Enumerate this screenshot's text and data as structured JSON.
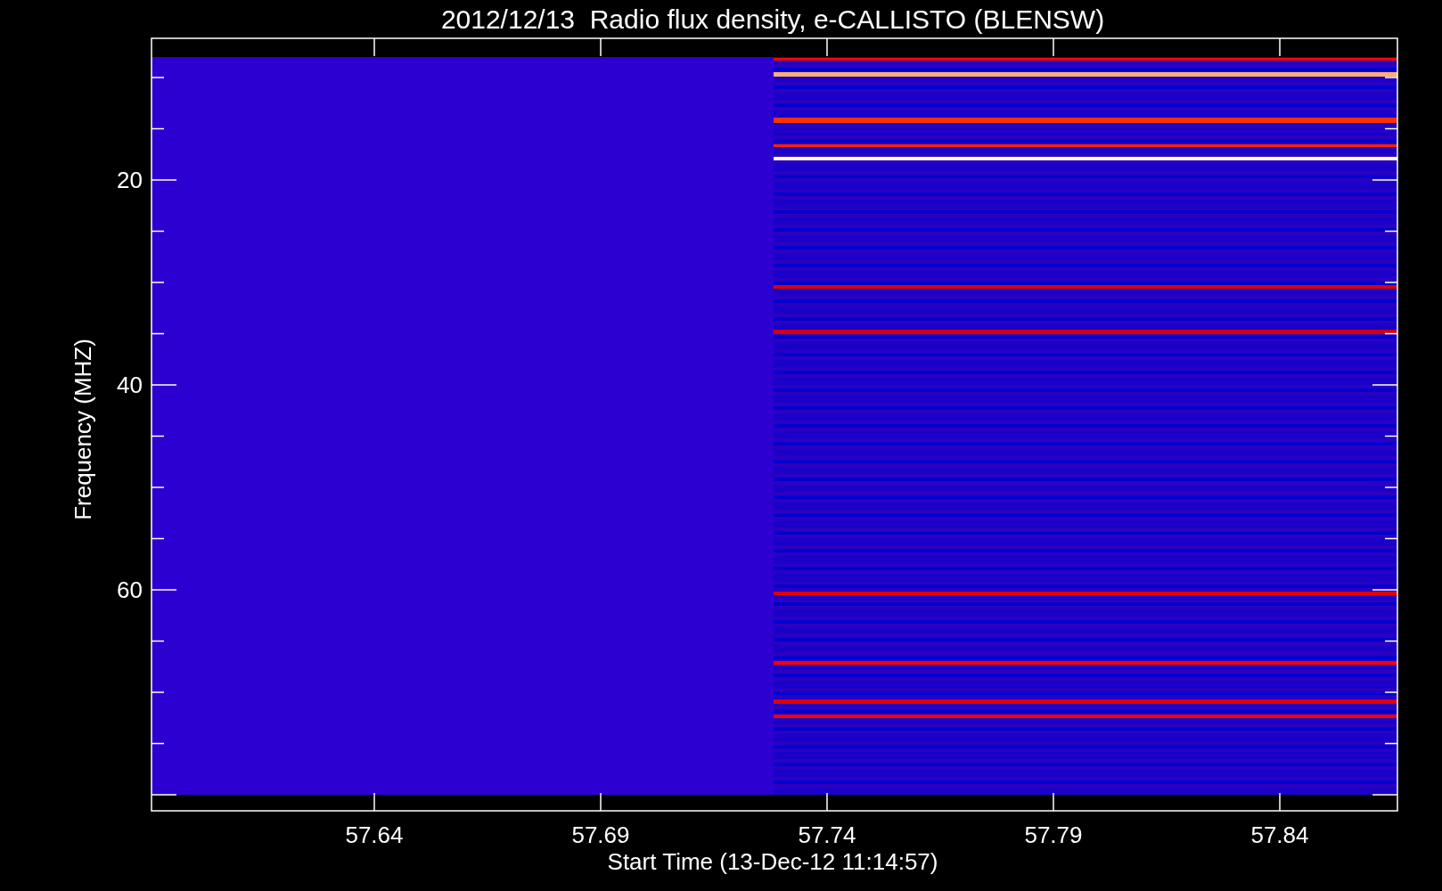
{
  "plot": {
    "title": "2012/12/13  Radio flux density, e-CALLISTO (BLENSW)",
    "xlabel": "Start Time (13-Dec-12 11:14:57)",
    "ylabel": "Frequency (MHZ)",
    "xticks": [
      "57.64",
      "57.69",
      "57.74",
      "57.79",
      "57.84"
    ],
    "yticks": [
      "20",
      "40",
      "60"
    ]
  }
}
